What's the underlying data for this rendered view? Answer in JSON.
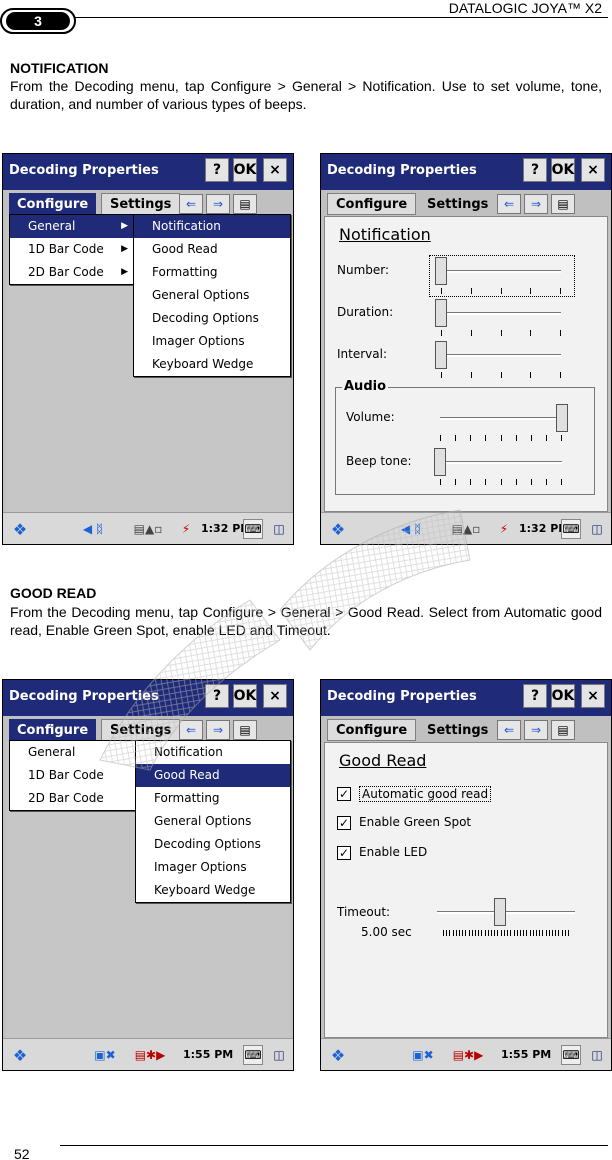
{
  "header": {
    "chapter": "3",
    "title": "DATALOGIC JOYA™ X2"
  },
  "footer": {
    "page": "52"
  },
  "sections": [
    {
      "heading": "NOTIFICATION",
      "body": "From the Decoding menu, tap Configure > General > Notification. Use to set volume, tone, duration, and number of various types of beeps."
    },
    {
      "heading": "GOOD READ",
      "body": "From the Decoding menu, tap Configure > General > Good Read. Select from Automatic good read, Enable Green Spot, enable LED and Timeout."
    }
  ],
  "app": {
    "window_title": "Decoding Properties",
    "help_label": "?",
    "ok_label": "OK",
    "close_label": "×",
    "menu_configure": "Configure",
    "menu_settings": "Settings",
    "submenu": [
      "General",
      "1D Bar Code",
      "2D Bar Code"
    ],
    "general_items": [
      "Notification",
      "Good Read",
      "Formatting",
      "General Options",
      "Decoding Options",
      "Imager Options",
      "Keyboard Wedge"
    ]
  },
  "screens": {
    "s1": {
      "time": "1:32 PM"
    },
    "s2": {
      "time": "1:32 PM",
      "pane_title": "Notification",
      "number_label": "Number:",
      "duration_label": "Duration:",
      "interval_label": "Interval:",
      "audio_group": "Audio",
      "volume_label": "Volume:",
      "tone_label": "Beep tone:",
      "number_level": 0,
      "duration_level": 0,
      "interval_level": 0,
      "volume_level": 1,
      "tone_level": 0
    },
    "s3": {
      "time": "1:55 PM"
    },
    "s4": {
      "time": "1:55 PM",
      "pane_title": "Good Read",
      "auto_label": "Automatic good read",
      "green_label": "Enable Green Spot",
      "led_label": "Enable LED",
      "auto_checked": true,
      "green_checked": true,
      "led_checked": true,
      "timeout_label": "Timeout:",
      "timeout_value": "5.00 sec",
      "timeout_level": 0.46
    }
  }
}
